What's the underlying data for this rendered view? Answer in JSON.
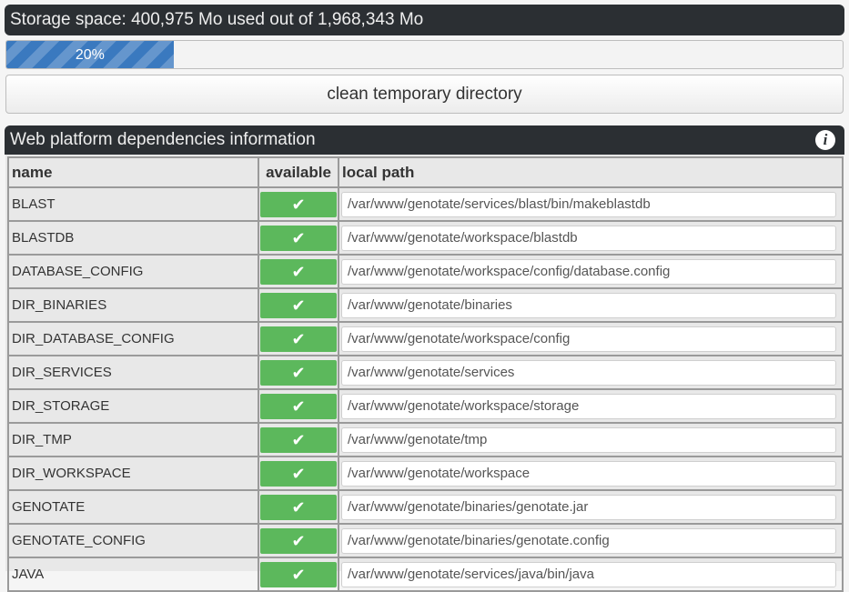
{
  "storage": {
    "header": "Storage space: 400,975 Mo used out of 1,968,343 Mo",
    "progress_percent": 20,
    "progress_label": "20%",
    "clean_button_label": "clean temporary directory"
  },
  "dependencies": {
    "header": "Web platform dependencies information",
    "info_icon": "i",
    "columns": {
      "name": "name",
      "available": "available",
      "path": "local path"
    },
    "check_glyph": "✔",
    "rows": [
      {
        "name": "BLAST",
        "available": true,
        "path": "/var/www/genotate/services/blast/bin/makeblastdb"
      },
      {
        "name": "BLASTDB",
        "available": true,
        "path": "/var/www/genotate/workspace/blastdb"
      },
      {
        "name": "DATABASE_CONFIG",
        "available": true,
        "path": "/var/www/genotate/workspace/config/database.config"
      },
      {
        "name": "DIR_BINARIES",
        "available": true,
        "path": "/var/www/genotate/binaries"
      },
      {
        "name": "DIR_DATABASE_CONFIG",
        "available": true,
        "path": "/var/www/genotate/workspace/config"
      },
      {
        "name": "DIR_SERVICES",
        "available": true,
        "path": "/var/www/genotate/services"
      },
      {
        "name": "DIR_STORAGE",
        "available": true,
        "path": "/var/www/genotate/workspace/storage"
      },
      {
        "name": "DIR_TMP",
        "available": true,
        "path": "/var/www/genotate/tmp"
      },
      {
        "name": "DIR_WORKSPACE",
        "available": true,
        "path": "/var/www/genotate/workspace"
      },
      {
        "name": "GENOTATE",
        "available": true,
        "path": "/var/www/genotate/binaries/genotate.jar"
      },
      {
        "name": "GENOTATE_CONFIG",
        "available": true,
        "path": "/var/www/genotate/binaries/genotate.config"
      },
      {
        "name": "JAVA",
        "available": true,
        "path": "/var/www/genotate/services/java/bin/java"
      }
    ]
  },
  "colors": {
    "header_bg": "#2b2f33",
    "progress_bar": "#3a79bf",
    "available_ok": "#5cb85c"
  }
}
